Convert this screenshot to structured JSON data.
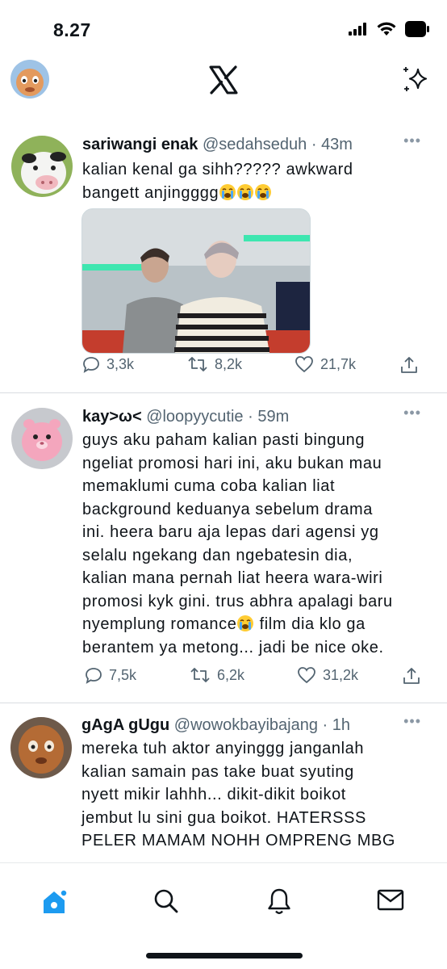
{
  "status_bar": {
    "time": "8.27"
  },
  "header": {
    "logo": "x-logo-icon",
    "action": "grok-sparkle-icon"
  },
  "tweets": [
    {
      "name": "sariwangi enak",
      "handle": "@sedahseduh",
      "separator": "·",
      "time": "43m",
      "text_lines": [
        "kalian kenal ga sihh????? awkward",
        "bangett anjingggg"
      ],
      "emoji": "loudly-crying-face",
      "replies": "3,3k",
      "reposts": "8,2k",
      "likes": "21,7k"
    },
    {
      "name": "kay>ω<",
      "handle": "@loopyycutie",
      "separator": "·",
      "time": "59m",
      "text_lines": [
        "guys aku paham kalian pasti bingung",
        "ngeliat promosi hari ini, aku bukan mau",
        "memaklumi cuma coba kalian liat",
        "background keduanya sebelum drama",
        "ini. heera baru aja lepas dari agensi yg",
        "selalu ngekang dan ngebatesin dia,",
        "kalian mana pernah liat heera wara-wiri",
        "promosi kyk gini. trus abhra apalagi baru",
        "nyemplung romance",
        " film dia klo ga",
        "berantem ya metong... jadi be nice oke."
      ],
      "replies": "7,5k",
      "reposts": "6,2k",
      "likes": "31,2k"
    },
    {
      "name": "gAgA gUgu",
      "handle": "@wowokbayibajang",
      "separator": "·",
      "time": "1h",
      "text_lines": [
        "mereka tuh aktor anyinggg janganlah",
        "kalian samain pas take buat syuting",
        "nyett mikir lahhh... dikit-dikit boikot",
        "jembut lu sini gua boikot. HATERSSS",
        "PELER MAMAM NOHH OMPRENG MBG"
      ]
    }
  ],
  "tab_bar": [
    "home-icon",
    "search-icon",
    "notifications-icon",
    "messages-icon"
  ],
  "colors": {
    "accent": "#1d9bf0",
    "text": "#0f1419",
    "muted": "#536471"
  }
}
